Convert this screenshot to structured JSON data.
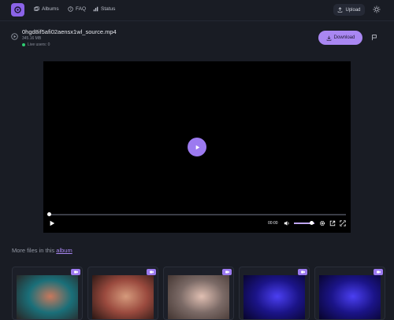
{
  "nav": {
    "albums": "Albums",
    "faq": "FAQ",
    "status": "Status",
    "upload": "Upload"
  },
  "file": {
    "name": "0hgd8if5afi02aensx1wl_source.mp4",
    "size": "345.16 MB",
    "live_users": "Live users: 0",
    "download_label": "Download"
  },
  "player": {
    "time": "00:00",
    "progress": 0,
    "volume": 0.85
  },
  "more": {
    "prefix": "More files in this",
    "link": "album"
  },
  "thumbnails": [
    {
      "type": "video",
      "palette": [
        "#1a6f79",
        "#c9785c",
        "#2b1c1a"
      ]
    },
    {
      "type": "video",
      "palette": [
        "#9a4a3e",
        "#d59a7c",
        "#1a100e"
      ]
    },
    {
      "type": "video",
      "palette": [
        "#7b6a66",
        "#e0bfb2",
        "#3b2e2a"
      ]
    },
    {
      "type": "video",
      "palette": [
        "#1b1488",
        "#4b3ff2",
        "#05021f"
      ]
    },
    {
      "type": "video",
      "palette": [
        "#1b1488",
        "#4b3ff2",
        "#05021f"
      ]
    }
  ],
  "colors": {
    "accent": "#a987f2",
    "background": "#191c24"
  }
}
